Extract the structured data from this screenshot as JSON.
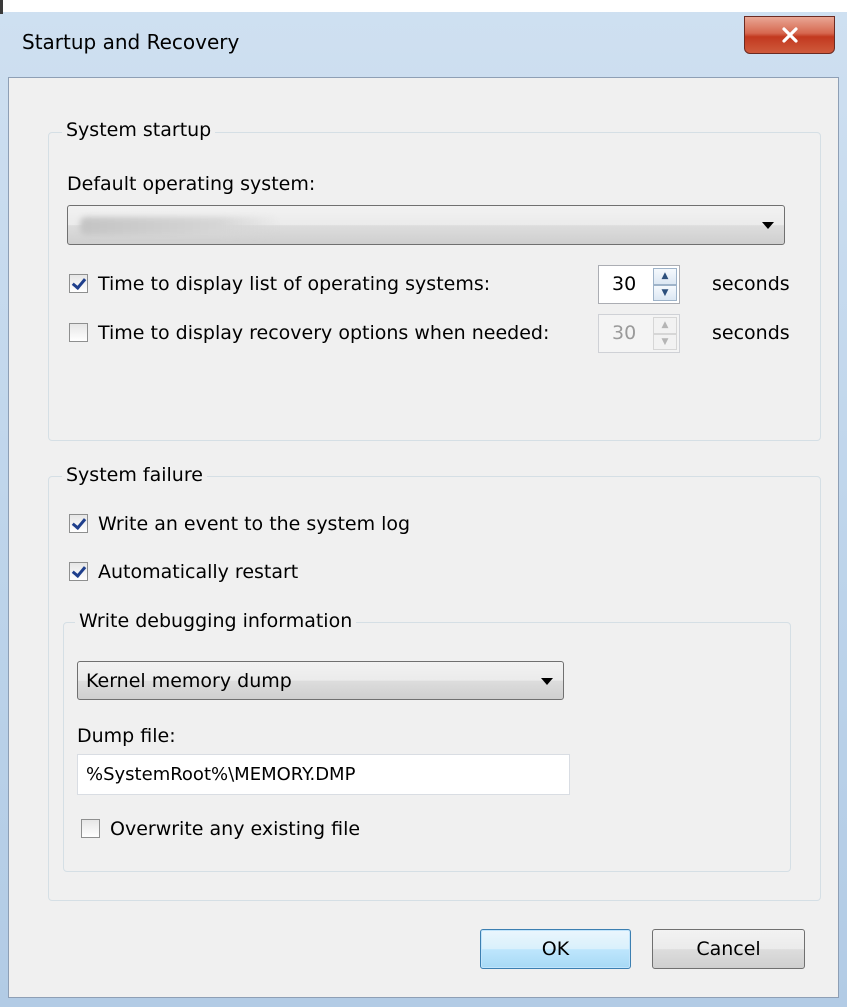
{
  "window": {
    "title": "Startup and Recovery"
  },
  "system_startup": {
    "group_title": "System startup",
    "default_os_label": "Default operating system:",
    "default_os_value": "",
    "list_os": {
      "checked": true,
      "label": "Time to display list of operating systems:",
      "value": "30",
      "unit": "seconds"
    },
    "recovery_options": {
      "checked": false,
      "label": "Time to display recovery options when needed:",
      "value": "30",
      "unit": "seconds"
    }
  },
  "system_failure": {
    "group_title": "System failure",
    "write_event": {
      "checked": true,
      "label": "Write an event to the system log"
    },
    "auto_restart": {
      "checked": true,
      "label": "Automatically restart"
    },
    "debug": {
      "group_title": "Write debugging information",
      "dump_type": "Kernel memory dump",
      "dump_file_label": "Dump file:",
      "dump_file_value": "%SystemRoot%\\MEMORY.DMP",
      "overwrite": {
        "checked": false,
        "label": "Overwrite any existing file"
      }
    }
  },
  "buttons": {
    "ok": "OK",
    "cancel": "Cancel"
  },
  "colors": {
    "close_button": "#c2391f",
    "frame": "#bcd3ea",
    "default_button_border": "#3c7fb1"
  },
  "icons": {
    "close": "close-icon",
    "dropdown": "chevron-down-icon",
    "spin_up": "spin-up-icon",
    "spin_down": "spin-down-icon"
  }
}
